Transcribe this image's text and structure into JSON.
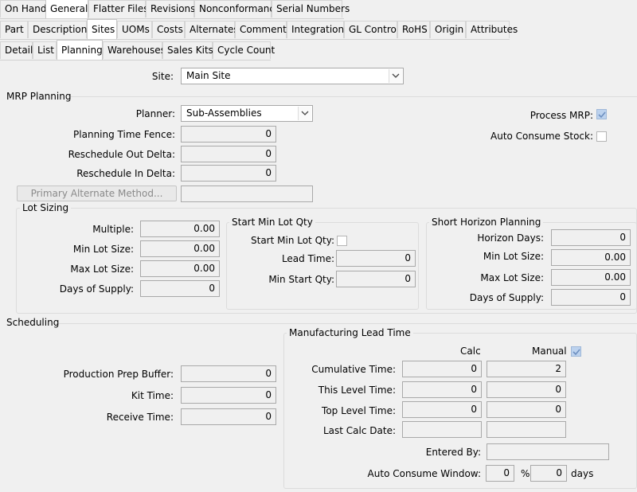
{
  "tabs_row1": [
    "On Hand",
    "General",
    "Flatter Files",
    "Revisions",
    "Nonconformance",
    "Serial Numbers"
  ],
  "tabs_row2": [
    "Part",
    "Descriptions",
    "Sites",
    "UOMs",
    "Costs",
    "Alternates",
    "Comments",
    "Integrations",
    "GL Control",
    "RoHS",
    "Origin",
    "Attributes"
  ],
  "tabs_row3": [
    "Detail",
    "List",
    "Planning",
    "Warehouses",
    "Sales Kits",
    "Cycle Count"
  ],
  "site": {
    "label": "Site:",
    "value": "Main Site"
  },
  "mrp": {
    "title": "MRP Planning",
    "planner_label": "Planner:",
    "planner_value": "Sub-Assemblies",
    "fence_label": "Planning Time Fence:",
    "fence_value": "0",
    "out_label": "Reschedule Out Delta:",
    "out_value": "0",
    "in_label": "Reschedule In Delta:",
    "in_value": "0",
    "alt_button": "Primary Alternate Method...",
    "alt_value": "",
    "process_label": "Process MRP:",
    "process_checked": true,
    "autoconsume_label": "Auto Consume Stock:",
    "autoconsume_checked": false
  },
  "lot_sizing": {
    "title": "Lot Sizing",
    "multiple_label": "Multiple:",
    "multiple_value": "0.00",
    "min_label": "Min Lot Size:",
    "min_value": "0.00",
    "max_label": "Max Lot Size:",
    "max_value": "0.00",
    "days_label": "Days of Supply:",
    "days_value": "0"
  },
  "start_min": {
    "title": "Start Min Lot Qty",
    "start_label": "Start Min Lot Qty:",
    "start_checked": false,
    "lead_label": "Lead Time:",
    "lead_value": "0",
    "minstart_label": "Min Start Qty:",
    "minstart_value": "0"
  },
  "short_horizon": {
    "title": "Short Horizon Planning",
    "horizon_label": "Horizon Days:",
    "horizon_value": "0",
    "min_label": "Min Lot Size:",
    "min_value": "0.00",
    "max_label": "Max Lot Size:",
    "max_value": "0.00",
    "days_label": "Days of Supply:",
    "days_value": "0"
  },
  "scheduling": {
    "title": "Scheduling",
    "prep_label": "Production Prep Buffer:",
    "prep_value": "0",
    "kit_label": "Kit Time:",
    "kit_value": "0",
    "receive_label": "Receive Time:",
    "receive_value": "0"
  },
  "mfg_lead": {
    "title": "Manufacturing Lead Time",
    "calc_header": "Calc",
    "manual_header": "Manual",
    "manual_checked": true,
    "cumulative_label": "Cumulative Time:",
    "cumulative_calc": "0",
    "cumulative_manual": "2",
    "this_label": "This Level Time:",
    "this_calc": "0",
    "this_manual": "0",
    "top_label": "Top Level Time:",
    "top_calc": "0",
    "top_manual": "0",
    "lastcalc_label": "Last Calc Date:",
    "lastcalc_calc": "",
    "lastcalc_manual": "",
    "entered_label": "Entered By:",
    "entered_value": "",
    "window_label": "Auto Consume Window:",
    "window_value": "0",
    "percent": "%",
    "days_value": "0",
    "days_unit": "days"
  }
}
